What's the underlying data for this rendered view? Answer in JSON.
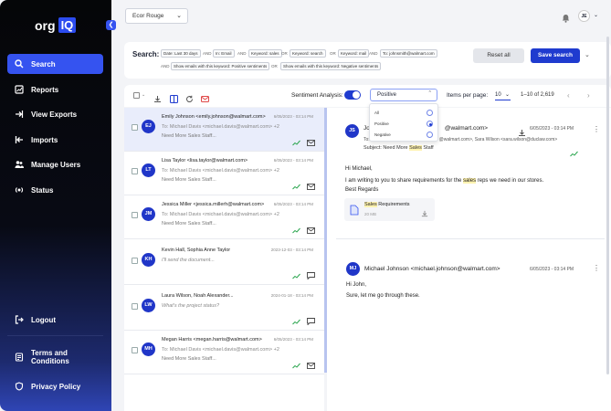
{
  "logo": {
    "prefix": "org",
    "suffix": "IQ"
  },
  "sidebar": {
    "items": [
      {
        "label": "Search",
        "icon": "search-icon"
      },
      {
        "label": "Reports",
        "icon": "reports-icon"
      },
      {
        "label": "View Exports",
        "icon": "export-icon"
      },
      {
        "label": "Imports",
        "icon": "import-icon"
      },
      {
        "label": "Manage Users",
        "icon": "users-icon"
      },
      {
        "label": "Status",
        "icon": "status-icon"
      }
    ],
    "logout": "Logout",
    "terms": "Terms and Conditions",
    "privacy": "Privacy Policy"
  },
  "header": {
    "client": "Ecor Rouge",
    "user_initials": "JE"
  },
  "search": {
    "label": "Search:",
    "row1": [
      "Date: Last 30 days",
      "AND",
      "In: Email",
      "AND",
      "Keyword: sales",
      "OR",
      "Keyword: search",
      "OR",
      "Keyword: mail",
      "AND",
      "To: johnsmith@walmart.com"
    ],
    "row2": [
      "AND",
      "Show emails with this keyword: Positive sentiments",
      "OR",
      "Show emails with this keyword: Negative sentiments"
    ],
    "reset_label": "Reset all",
    "save_label": "Save search"
  },
  "toolbar": {
    "sentiment_label": "Sentiment Analysis:",
    "sentiment_value": "Positive",
    "items_per_page_label": "Items per page:",
    "items_per_page": "10",
    "range": "1–10 of 2,619"
  },
  "sentiment_options": [
    {
      "label": "All",
      "selected": false
    },
    {
      "label": "Positive",
      "selected": true
    },
    {
      "label": "Negative",
      "selected": false
    }
  ],
  "emails": [
    {
      "initials": "EJ",
      "from": "Emily Johnson <emily.johnson@walmart.com>",
      "date": "6/05/2023 - 03:14 PM",
      "to": "To: Michael Davis <michael.davis@walmart.com> +2",
      "subject": "Need More Sales Staff...",
      "selected": true
    },
    {
      "initials": "LT",
      "from": "Lisa Taylor <lisa.taylor@walmart.com>",
      "date": "6/05/2023 - 03:14 PM",
      "to": "To: Michael Davis <michael.davis@walmart.com> +2",
      "subject": "Need More Sales Staff...",
      "selected": false
    },
    {
      "initials": "JM",
      "from": "Jessica Miller <jessica.millerh@walmart.com>",
      "date": "6/05/2023 - 03:14 PM",
      "to": "To: Michael Davis <michael.davis@walmart.com> +2",
      "subject": "Need More Sales Staff...",
      "selected": false
    },
    {
      "initials": "KH",
      "from": "Kevin Hall, Sophia Anne Taylor",
      "date": "2023-12-03 - 03:14 PM",
      "to": "I'll send the document...",
      "subject": "",
      "selected": false
    },
    {
      "initials": "LW",
      "from": "Laura Wilson, Noah Alexander...",
      "date": "2024-01-18 - 03:14 PM",
      "to": "What's the project status?",
      "subject": "",
      "selected": false
    },
    {
      "initials": "MH",
      "from": "Megan Harris <megan.harris@walmart.com>",
      "date": "6/05/2023 - 03:14 PM",
      "to": "To: Michael Davis <michael.davis@walmart.com> +2",
      "subject": "Need More Sales Staff...",
      "selected": false
    }
  ],
  "detail": {
    "msg1": {
      "initials": "JS",
      "from_pre": "Jo",
      "from_post": "@walmart.com>",
      "date": "6/05/2023 - 03:14 PM",
      "to_pre": "To:",
      "to_post": "@walmart.com>, Sara Wilson <sara.wilson@duclaw.com>",
      "subject_pre": "Subject: Need More ",
      "subject_hl": "Sales",
      "subject_post": " Staff",
      "greeting": "Hi Michael,",
      "body_pre": "I am writing to you to share requirements for the ",
      "body_hl": "sales",
      "body_post": " reps we need in our stores.",
      "signoff": "Best Regards",
      "attachment_hl": "Sales",
      "attachment_rest": " Requirements",
      "attachment_size": "20 MB"
    },
    "msg2": {
      "initials": "MJ",
      "from": "Michael Johnson <michael.johnson@walmart.com>",
      "date": "6/05/2023 - 03:14 PM",
      "greeting": "Hi John,",
      "body": "Sure, let me go through these."
    }
  }
}
